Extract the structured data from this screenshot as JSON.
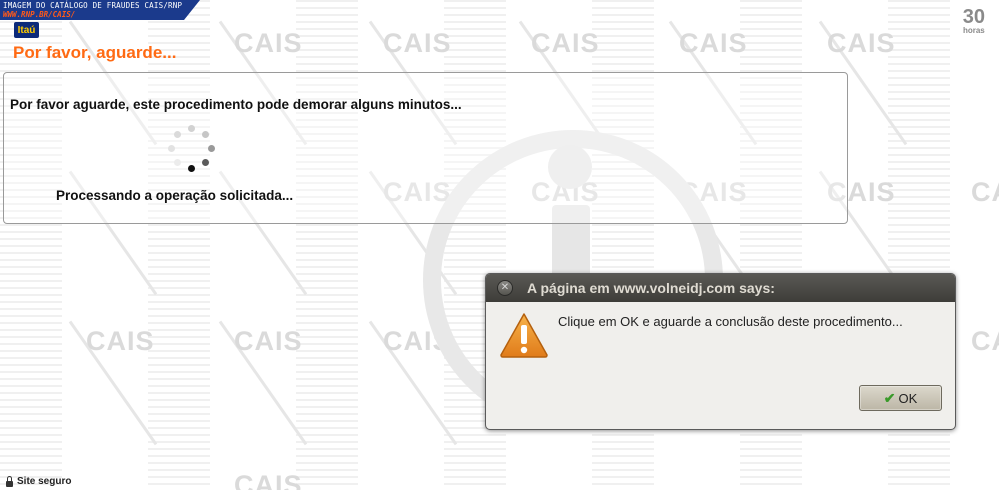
{
  "banner": {
    "title": "IMAGEM DO CATÁLOGO DE FRAUDES CAIS/RNP",
    "url": "WWW.RNP.BR/CAIS/"
  },
  "logo": {
    "text": "Itaú"
  },
  "badge": {
    "number": "30",
    "label": "horas"
  },
  "watermark": {
    "text": "CAIS"
  },
  "page": {
    "title": "Por favor, aguarde..."
  },
  "panel": {
    "message": "Por favor aguarde, este procedimento pode demorar alguns minutos...",
    "processing": "Processando a operação solicitada...",
    "spinner_icon": "loading-spinner-icon"
  },
  "dialog": {
    "title": "A página em www.volneidj.com says:",
    "message": "Clique em OK e aguarde a conclusão deste procedimento...",
    "icon": "warning-icon",
    "close_icon": "close-icon",
    "ok_label": "OK"
  },
  "footer": {
    "label": "Site seguro"
  },
  "colors": {
    "accent": "#ff6a13",
    "banner": "#1b3a8c",
    "dialog_titlebar": "#4a4945"
  }
}
